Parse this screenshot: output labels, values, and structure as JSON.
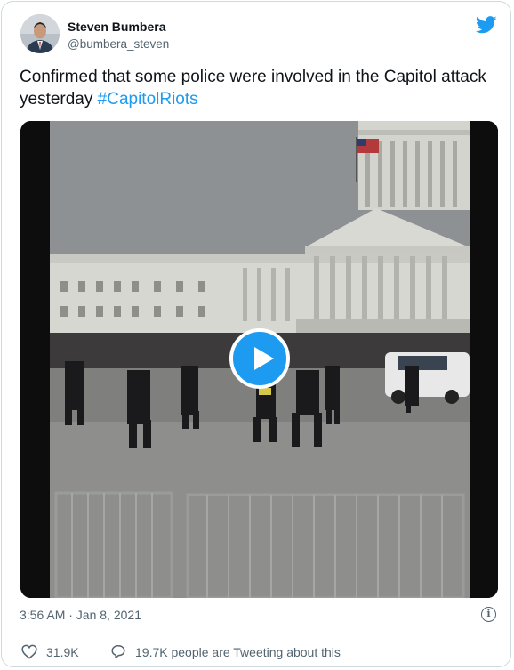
{
  "author": {
    "name": "Steven Bumbera",
    "handle": "@bumbera_steven"
  },
  "tweet": {
    "text": "Confirmed that some police were involved in the Capitol attack yesterday ",
    "hashtag": "#CapitolRiots"
  },
  "meta": {
    "timestamp": "3:56 AM · Jan 8, 2021",
    "info_icon": "i"
  },
  "engagement": {
    "likes": "31.9K",
    "conversation": "19.7K people are Tweeting about this"
  },
  "colors": {
    "accent": "#1d9bf0",
    "secondary_text": "#536471",
    "primary_text": "#0f1419"
  },
  "icons": {
    "logo": "twitter-bird-icon",
    "play": "play-icon",
    "like": "heart-icon",
    "reply": "speech-bubble-icon",
    "info": "info-icon"
  }
}
